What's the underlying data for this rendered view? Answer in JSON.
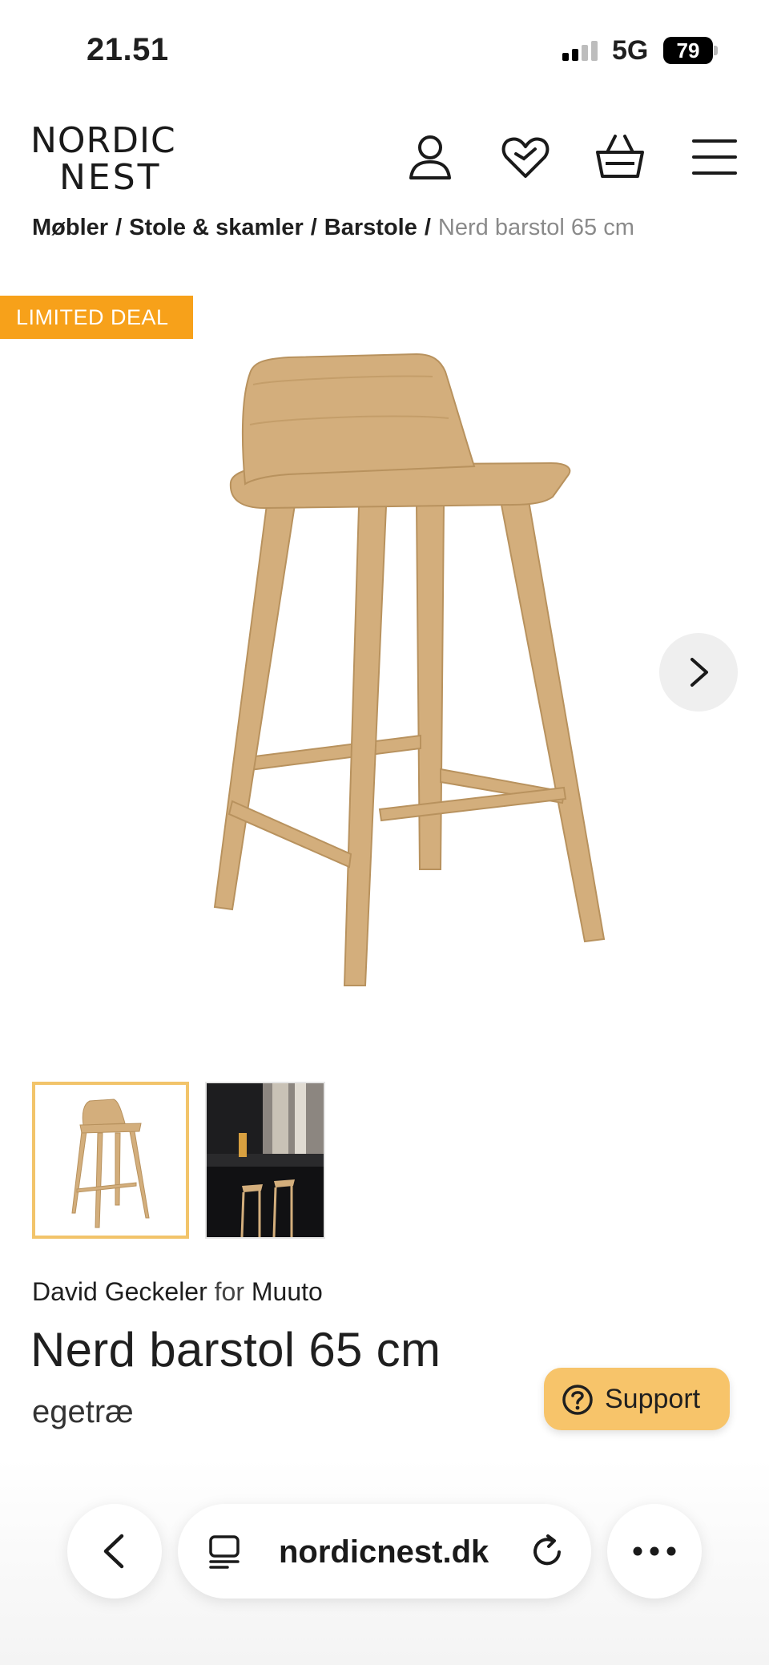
{
  "status_bar": {
    "time": "21.51",
    "network": "5G",
    "battery": "79"
  },
  "header": {
    "logo_line1": "NORDIC",
    "logo_line2": "NEST",
    "icons": [
      "user-icon",
      "heart-icon",
      "basket-icon",
      "menu-icon"
    ]
  },
  "breadcrumb": {
    "items": [
      "Møbler",
      "Stole & skamler",
      "Barstole"
    ],
    "separator": "/",
    "current": "Nerd barstol 65 cm"
  },
  "product": {
    "badge": "LIMITED DEAL",
    "designer": "David Geckeler",
    "for_word": "for",
    "brand": "Muuto",
    "title": "Nerd barstol 65 cm",
    "variant": "egetræ",
    "thumbnail_count": 2,
    "selected_thumbnail": 1
  },
  "support": {
    "label": "Support"
  },
  "browser": {
    "url": "nordicnest.dk"
  },
  "colors": {
    "badge": "#f7a11a",
    "support": "#f7c46a",
    "thumb_selected": "#f2c46a",
    "wood": "#d3ae7c"
  }
}
